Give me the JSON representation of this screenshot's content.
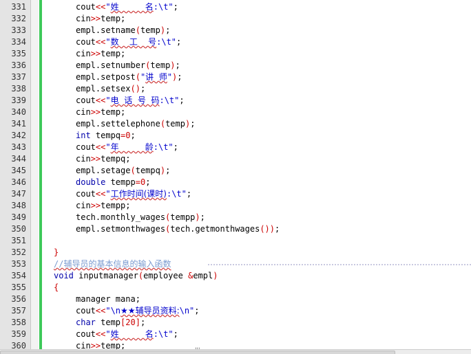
{
  "editor": {
    "lines": [
      {
        "n": "331",
        "indent": 1,
        "tokens": [
          [
            "fn",
            "cout"
          ],
          [
            "op",
            "<<"
          ],
          [
            "str",
            "\""
          ],
          [
            "cn",
            "姓          名"
          ],
          [
            "str",
            ":\\t\""
          ],
          [
            "fn",
            ";"
          ]
        ]
      },
      {
        "n": "332",
        "indent": 1,
        "tokens": [
          [
            "fn",
            "cin"
          ],
          [
            "op",
            ">>"
          ],
          [
            "fn",
            "temp;"
          ]
        ]
      },
      {
        "n": "333",
        "indent": 1,
        "tokens": [
          [
            "fn",
            "empl.setname"
          ],
          [
            "op",
            "("
          ],
          [
            "fn",
            "temp"
          ],
          [
            "op",
            ")"
          ],
          [
            "fn",
            ";"
          ]
        ]
      },
      {
        "n": "334",
        "indent": 1,
        "tokens": [
          [
            "fn",
            "cout"
          ],
          [
            "op",
            "<<"
          ],
          [
            "str",
            "\""
          ],
          [
            "cn",
            "数    工    号"
          ],
          [
            "str",
            ":\\t\""
          ],
          [
            "fn",
            ";"
          ]
        ]
      },
      {
        "n": "335",
        "indent": 1,
        "tokens": [
          [
            "fn",
            "cin"
          ],
          [
            "op",
            ">>"
          ],
          [
            "fn",
            "temp;"
          ]
        ]
      },
      {
        "n": "336",
        "indent": 1,
        "tokens": [
          [
            "fn",
            "empl.setnumber"
          ],
          [
            "op",
            "("
          ],
          [
            "fn",
            "temp"
          ],
          [
            "op",
            ")"
          ],
          [
            "fn",
            ";"
          ]
        ]
      },
      {
        "n": "337",
        "indent": 1,
        "tokens": [
          [
            "fn",
            "empl.setpost"
          ],
          [
            "op",
            "("
          ],
          [
            "str",
            "\""
          ],
          [
            "cn",
            "讲  师"
          ],
          [
            "str",
            "\""
          ],
          [
            "op",
            ")"
          ],
          [
            "fn",
            ";"
          ]
        ]
      },
      {
        "n": "338",
        "indent": 1,
        "tokens": [
          [
            "fn",
            "empl.setsex"
          ],
          [
            "op",
            "()"
          ],
          [
            "fn",
            ";"
          ]
        ]
      },
      {
        "n": "339",
        "indent": 1,
        "tokens": [
          [
            "fn",
            "cout"
          ],
          [
            "op",
            "<<"
          ],
          [
            "str",
            "\""
          ],
          [
            "cn",
            "电  话  号  码"
          ],
          [
            "str",
            ":\\t\""
          ],
          [
            "fn",
            ";"
          ]
        ]
      },
      {
        "n": "340",
        "indent": 1,
        "tokens": [
          [
            "fn",
            "cin"
          ],
          [
            "op",
            ">>"
          ],
          [
            "fn",
            "temp;"
          ]
        ]
      },
      {
        "n": "341",
        "indent": 1,
        "tokens": [
          [
            "fn",
            "empl.settelephone"
          ],
          [
            "op",
            "("
          ],
          [
            "fn",
            "temp"
          ],
          [
            "op",
            ")"
          ],
          [
            "fn",
            ";"
          ]
        ]
      },
      {
        "n": "342",
        "indent": 1,
        "tokens": [
          [
            "kw",
            "int"
          ],
          [
            "fn",
            " tempq"
          ],
          [
            "op",
            "="
          ],
          [
            "num",
            "0"
          ],
          [
            "fn",
            ";"
          ]
        ]
      },
      {
        "n": "343",
        "indent": 1,
        "tokens": [
          [
            "fn",
            "cout"
          ],
          [
            "op",
            "<<"
          ],
          [
            "str",
            "\""
          ],
          [
            "cn",
            "年          龄"
          ],
          [
            "str",
            ":\\t\""
          ],
          [
            "fn",
            ";"
          ]
        ]
      },
      {
        "n": "344",
        "indent": 1,
        "tokens": [
          [
            "fn",
            "cin"
          ],
          [
            "op",
            ">>"
          ],
          [
            "fn",
            "tempq;"
          ]
        ]
      },
      {
        "n": "345",
        "indent": 1,
        "tokens": [
          [
            "fn",
            "empl.setage"
          ],
          [
            "op",
            "("
          ],
          [
            "fn",
            "tempq"
          ],
          [
            "op",
            ")"
          ],
          [
            "fn",
            ";"
          ]
        ]
      },
      {
        "n": "346",
        "indent": 1,
        "tokens": [
          [
            "kw",
            "double"
          ],
          [
            "fn",
            " tempp"
          ],
          [
            "op",
            "="
          ],
          [
            "num",
            "0"
          ],
          [
            "fn",
            ";"
          ]
        ]
      },
      {
        "n": "347",
        "indent": 1,
        "tokens": [
          [
            "fn",
            "cout"
          ],
          [
            "op",
            "<<"
          ],
          [
            "str",
            "\""
          ],
          [
            "cn",
            "工作时间(课时)"
          ],
          [
            "str",
            ":\\t\""
          ],
          [
            "fn",
            ";"
          ]
        ]
      },
      {
        "n": "348",
        "indent": 1,
        "tokens": [
          [
            "fn",
            "cin"
          ],
          [
            "op",
            ">>"
          ],
          [
            "fn",
            "tempp;"
          ]
        ]
      },
      {
        "n": "349",
        "indent": 1,
        "tokens": [
          [
            "fn",
            "tech.monthly_wages"
          ],
          [
            "op",
            "("
          ],
          [
            "fn",
            "tempp"
          ],
          [
            "op",
            ")"
          ],
          [
            "fn",
            ";"
          ]
        ]
      },
      {
        "n": "350",
        "indent": 1,
        "tokens": [
          [
            "fn",
            "empl.setmonthwages"
          ],
          [
            "op",
            "("
          ],
          [
            "fn",
            "tech.getmonthwages"
          ],
          [
            "op",
            "())"
          ],
          [
            "fn",
            ";"
          ]
        ]
      },
      {
        "n": "351",
        "indent": 0,
        "tokens": []
      },
      {
        "n": "352",
        "indent": 0,
        "tokens": [
          [
            "op",
            "}"
          ]
        ]
      },
      {
        "n": "353",
        "indent": 0,
        "tokens": [
          [
            "cmt",
            "//辅导员的基本信息的输入函数"
          ]
        ],
        "comment_rule": true
      },
      {
        "n": "354",
        "indent": 0,
        "tokens": [
          [
            "kw",
            "void"
          ],
          [
            "fn",
            " inputmanager"
          ],
          [
            "op",
            "("
          ],
          [
            "fn",
            "employee "
          ],
          [
            "op",
            "&"
          ],
          [
            "fn",
            "empl"
          ],
          [
            "op",
            ")"
          ]
        ]
      },
      {
        "n": "355",
        "indent": 0,
        "tokens": [
          [
            "op",
            "{"
          ]
        ]
      },
      {
        "n": "356",
        "indent": 1,
        "tokens": [
          [
            "fn",
            "manager mana;"
          ]
        ]
      },
      {
        "n": "357",
        "indent": 1,
        "tokens": [
          [
            "fn",
            "cout"
          ],
          [
            "op",
            "<<"
          ],
          [
            "str",
            "\"\\n"
          ],
          [
            "cn",
            "★★辅导员资料:"
          ],
          [
            "str",
            "\\n\""
          ],
          [
            "fn",
            ";"
          ]
        ]
      },
      {
        "n": "358",
        "indent": 1,
        "tokens": [
          [
            "kw",
            "char"
          ],
          [
            "fn",
            " temp"
          ],
          [
            "op",
            "["
          ],
          [
            "num",
            "20"
          ],
          [
            "op",
            "]"
          ],
          [
            "fn",
            ";"
          ]
        ]
      },
      {
        "n": "359",
        "indent": 1,
        "tokens": [
          [
            "fn",
            "cout"
          ],
          [
            "op",
            "<<"
          ],
          [
            "str",
            "\""
          ],
          [
            "cn",
            "姓          名"
          ],
          [
            "str",
            ":\\t\""
          ],
          [
            "fn",
            ";"
          ]
        ]
      },
      {
        "n": "360",
        "indent": 1,
        "tokens": [
          [
            "fn",
            "cin"
          ],
          [
            "op",
            ">>"
          ],
          [
            "fn",
            "temp;"
          ]
        ]
      }
    ]
  },
  "scrollbar": {
    "grip_glyph": "'''"
  },
  "colors": {
    "gutter": "#e4e4e4",
    "change_bar": "#3ec95a",
    "operator": "#cc0000",
    "string": "#0000cc",
    "keyword": "#0000aa",
    "comment": "#7a9bd0"
  }
}
